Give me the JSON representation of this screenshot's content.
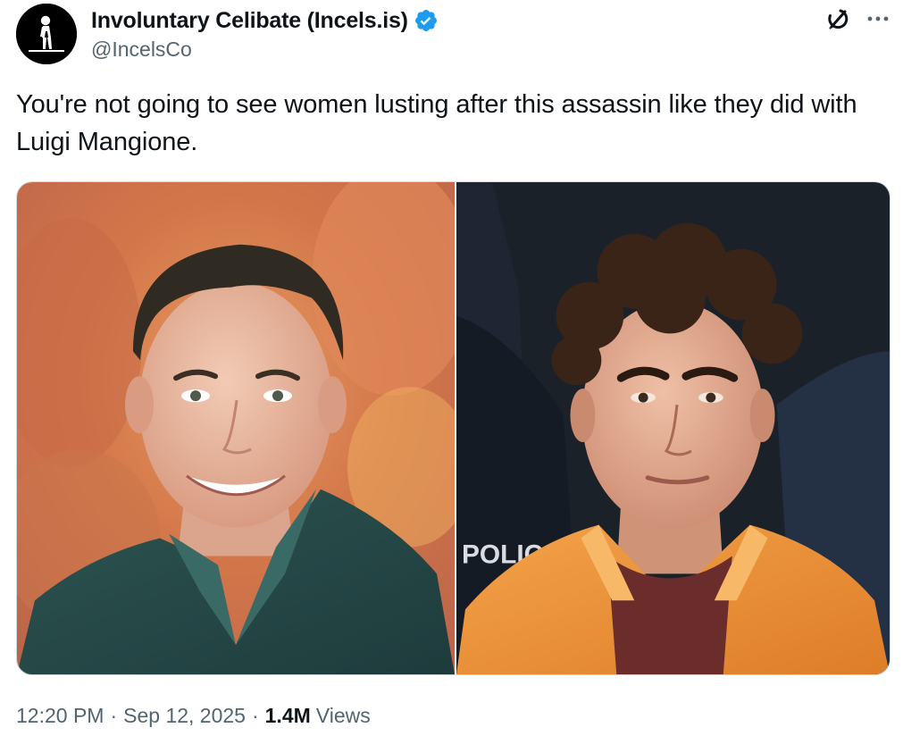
{
  "author": {
    "display_name": "Involuntary Celibate (Incels.is)",
    "handle": "@IncelsCo",
    "verified": true,
    "avatar_icon": "man-silhouette-icon"
  },
  "actions": {
    "grok_icon": "grok-icon",
    "more_icon": "more-options-icon"
  },
  "tweet": {
    "text": "You're not going to see women lusting after this assassin like they did with Luigi Mangione."
  },
  "media": [
    {
      "description": "photo",
      "side": "left"
    },
    {
      "description": "photo",
      "side": "right",
      "visible_text": "POLIC"
    }
  ],
  "meta": {
    "time": "12:20 PM",
    "separator": "·",
    "date": "Sep 12, 2025",
    "views_count": "1.4M",
    "views_label": "Views"
  },
  "colors": {
    "text_primary": "#0f1419",
    "text_secondary": "#536471",
    "verified_blue": "#1d9bf0",
    "border": "#cfd9de"
  }
}
